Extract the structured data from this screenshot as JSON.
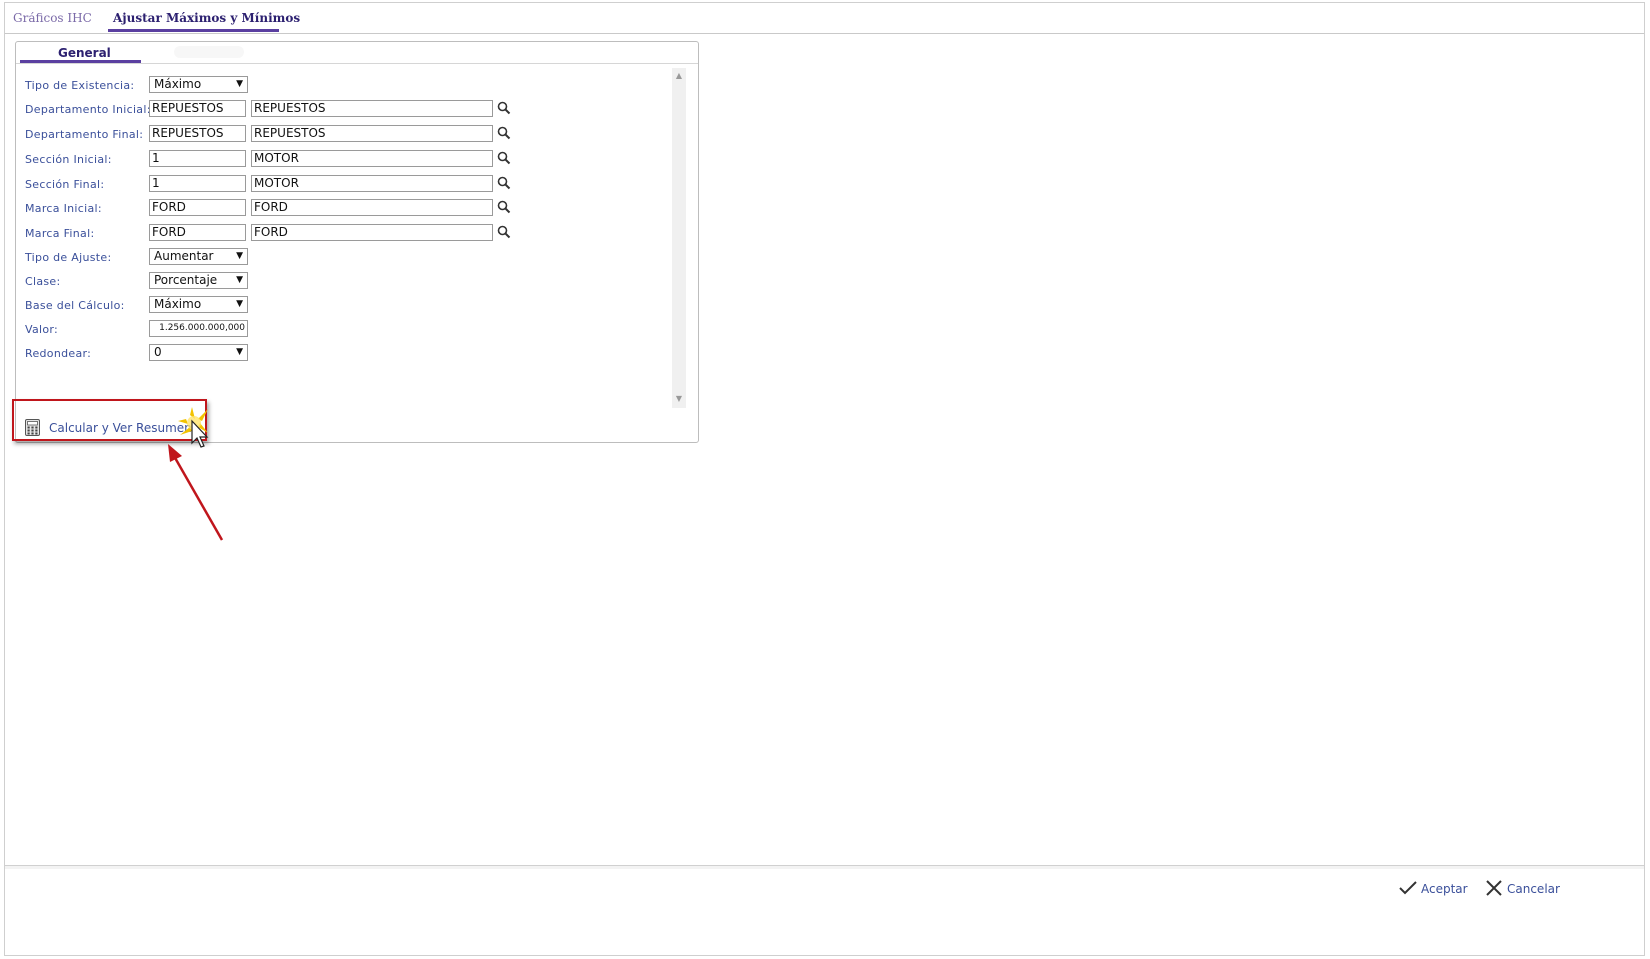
{
  "tabs": {
    "graficos": "Gráficos IHC",
    "ajustar": "Ajustar Máximos y Mínimos"
  },
  "panel": {
    "tab_general": "General"
  },
  "form": {
    "tipo_existencia": {
      "label": "Tipo de Existencia:",
      "value": "Máximo"
    },
    "depto_inicial": {
      "label": "Departamento Inicial:",
      "code": "REPUESTOS",
      "desc": "REPUESTOS"
    },
    "depto_final": {
      "label": "Departamento Final:",
      "code": "REPUESTOS",
      "desc": "REPUESTOS"
    },
    "seccion_inicial": {
      "label": "Sección Inicial:",
      "code": "1",
      "desc": "MOTOR"
    },
    "seccion_final": {
      "label": "Sección Final:",
      "code": "1",
      "desc": "MOTOR"
    },
    "marca_inicial": {
      "label": "Marca Inicial:",
      "code": "FORD",
      "desc": "FORD"
    },
    "marca_final": {
      "label": "Marca Final:",
      "code": "FORD",
      "desc": "FORD"
    },
    "tipo_ajuste": {
      "label": "Tipo de Ajuste:",
      "value": "Aumentar"
    },
    "clase": {
      "label": "Clase:",
      "value": "Porcentaje"
    },
    "base_calculo": {
      "label": "Base del Cálculo:",
      "value": "Máximo"
    },
    "valor": {
      "label": "Valor:",
      "value": "1.256.000.000,000"
    },
    "redondear": {
      "label": "Redondear:",
      "value": "0"
    }
  },
  "actions": {
    "calcular": "Calcular y Ver Resumen"
  },
  "footer": {
    "aceptar": "Aceptar",
    "cancelar": "Cancelar"
  },
  "colors": {
    "accent": "#5a3fa0",
    "label": "#3a4f9a",
    "highlight": "#c0161c"
  },
  "icons": {
    "lookup": "search-icon",
    "calc": "calculator-icon",
    "ok": "check-icon",
    "cancel": "close-icon"
  }
}
